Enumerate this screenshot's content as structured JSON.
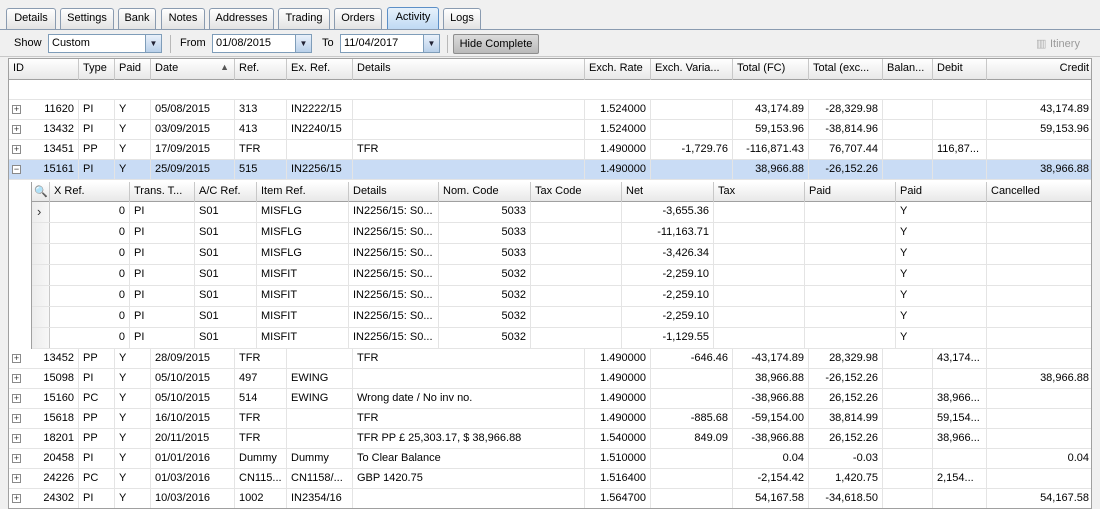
{
  "tabs": [
    {
      "label": "Details",
      "active": false
    },
    {
      "label": "Settings",
      "active": false
    },
    {
      "label": "Bank",
      "active": false
    },
    {
      "label": "Notes",
      "active": false
    },
    {
      "label": "Addresses",
      "active": false
    },
    {
      "label": "Trading",
      "active": false
    },
    {
      "label": "Orders",
      "active": false
    },
    {
      "label": "Activity",
      "active": true
    },
    {
      "label": "Logs",
      "active": false
    }
  ],
  "toolbar": {
    "show_label": "Show",
    "show_value": "Custom",
    "from_label": "From",
    "from_value": "01/08/2015",
    "to_label": "To",
    "to_value": "11/04/2017",
    "hide_complete": "Hide Complete",
    "itinery": "Itinery"
  },
  "grid": {
    "columns": [
      "ID",
      "Type",
      "Paid",
      "Date",
      "Ref.",
      "Ex. Ref.",
      "Details",
      "Exch. Rate",
      "Exch. Varia...",
      "Total (FC)",
      "Total (exc...",
      "Balan...",
      "Debit",
      "Credit"
    ],
    "rows_top": [
      [
        "11620",
        "PI",
        "Y",
        "05/08/2015",
        "313",
        "IN2222/15",
        "",
        "1.524000",
        "",
        "43,174.89",
        "-28,329.98",
        "",
        "",
        "43,174.89"
      ],
      [
        "13432",
        "PI",
        "Y",
        "03/09/2015",
        "413",
        "IN2240/15",
        "",
        "1.524000",
        "",
        "59,153.96",
        "-38,814.96",
        "",
        "",
        "59,153.96"
      ],
      [
        "13451",
        "PP",
        "Y",
        "17/09/2015",
        "TFR",
        "",
        "TFR",
        "1.490000",
        "-1,729.76",
        "-116,871.43",
        "76,707.44",
        "",
        "116,87...",
        ""
      ],
      [
        "15161",
        "PI",
        "Y",
        "25/09/2015",
        "515",
        "IN2256/15",
        "",
        "1.490000",
        "",
        "38,966.88",
        "-26,152.26",
        "",
        "",
        "38,966.88"
      ]
    ],
    "rows_bottom": [
      [
        "13452",
        "PP",
        "Y",
        "28/09/2015",
        "TFR",
        "",
        "TFR",
        "1.490000",
        "-646.46",
        "-43,174.89",
        "28,329.98",
        "",
        "43,174...",
        ""
      ],
      [
        "15098",
        "PI",
        "Y",
        "05/10/2015",
        "497",
        "EWING",
        "",
        "1.490000",
        "",
        "38,966.88",
        "-26,152.26",
        "",
        "",
        "38,966.88"
      ],
      [
        "15160",
        "PC",
        "Y",
        "05/10/2015",
        "514",
        "EWING",
        "Wrong date / No inv no.",
        "1.490000",
        "",
        "-38,966.88",
        "26,152.26",
        "",
        "38,966...",
        ""
      ],
      [
        "15618",
        "PP",
        "Y",
        "16/10/2015",
        "TFR",
        "",
        "TFR",
        "1.490000",
        "-885.68",
        "-59,154.00",
        "38,814.99",
        "",
        "59,154...",
        ""
      ],
      [
        "18201",
        "PP",
        "Y",
        "20/11/2015",
        "TFR",
        "",
        "TFR PP £ 25,303.17, $ 38,966.88",
        "1.540000",
        "849.09",
        "-38,966.88",
        "26,152.26",
        "",
        "38,966...",
        ""
      ],
      [
        "20458",
        "PI",
        "Y",
        "01/01/2016",
        "Dummy",
        "Dummy",
        "To Clear Balance",
        "1.510000",
        "",
        "0.04",
        "-0.03",
        "",
        "",
        "0.04"
      ],
      [
        "24226",
        "PC",
        "Y",
        "01/03/2016",
        "CN115...",
        "CN1158/...",
        "GBP 1420.75",
        "1.516400",
        "",
        "-2,154.42",
        "1,420.75",
        "",
        "2,154...",
        ""
      ],
      [
        "24302",
        "PI",
        "Y",
        "10/03/2016",
        "1002",
        "IN2354/16",
        "",
        "1.564700",
        "",
        "54,167.58",
        "-34,618.50",
        "",
        "",
        "54,167.58"
      ]
    ]
  },
  "detail": {
    "columns": [
      "X Ref.",
      "Trans. T...",
      "A/C Ref.",
      "Item Ref.",
      "Details",
      "Nom. Code",
      "Tax Code",
      "Net",
      "Tax",
      "Paid",
      "Paid",
      "Cancelled"
    ],
    "rows": [
      [
        "0",
        "PI",
        "S01",
        "MISFLG",
        "IN2256/15: S0...",
        "5033",
        "",
        "-3,655.36",
        "",
        "",
        "Y",
        ""
      ],
      [
        "0",
        "PI",
        "S01",
        "MISFLG",
        "IN2256/15: S0...",
        "5033",
        "",
        "-11,163.71",
        "",
        "",
        "Y",
        ""
      ],
      [
        "0",
        "PI",
        "S01",
        "MISFLG",
        "IN2256/15: S0...",
        "5033",
        "",
        "-3,426.34",
        "",
        "",
        "Y",
        ""
      ],
      [
        "0",
        "PI",
        "S01",
        "MISFIT",
        "IN2256/15: S0...",
        "5032",
        "",
        "-2,259.10",
        "",
        "",
        "Y",
        ""
      ],
      [
        "0",
        "PI",
        "S01",
        "MISFIT",
        "IN2256/15: S0...",
        "5032",
        "",
        "-2,259.10",
        "",
        "",
        "Y",
        ""
      ],
      [
        "0",
        "PI",
        "S01",
        "MISFIT",
        "IN2256/15: S0...",
        "5032",
        "",
        "-2,259.10",
        "",
        "",
        "Y",
        ""
      ],
      [
        "0",
        "PI",
        "S01",
        "MISFIT",
        "IN2256/15: S0...",
        "5032",
        "",
        "-1,129.55",
        "",
        "",
        "Y",
        ""
      ]
    ]
  }
}
